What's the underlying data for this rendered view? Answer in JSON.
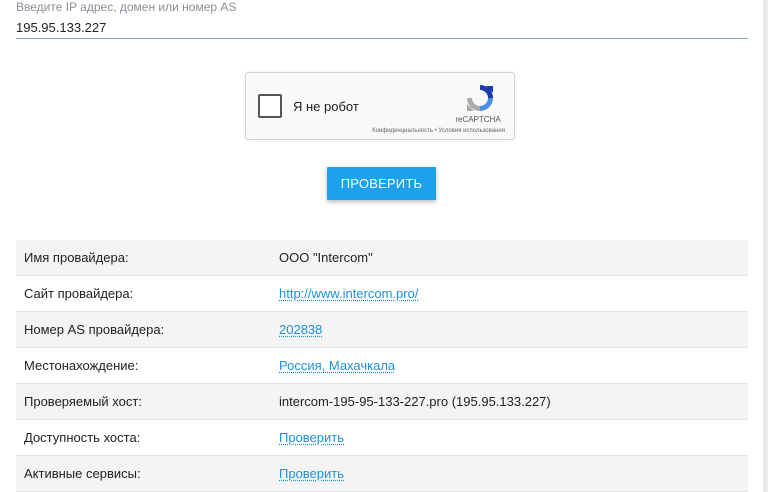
{
  "search": {
    "label": "Введите IP адрес, домен или номер AS",
    "value": "195.95.133.227"
  },
  "captcha": {
    "checkbox_label": "Я не робот",
    "brand": "reCAPTCHA",
    "links": "Конфиденциальность • Условия использования",
    "logo_icon": "recaptcha-logo-icon"
  },
  "check_button": {
    "label": "ПРОВЕРИТЬ",
    "color": "#1ea1ec"
  },
  "info": {
    "rows": [
      {
        "key": "Имя провайдера:",
        "value": "ООО \"Intercom\""
      },
      {
        "key": "Сайт провайдера:",
        "value": "http://www.intercom.pro/"
      },
      {
        "key": "Номер AS провайдера:",
        "value": "202838"
      },
      {
        "key": "Местонахождение:",
        "value": "Россия, Махачкала"
      },
      {
        "key": "Проверяемый хост:",
        "value": "intercom-195-95-133-227.pro (195.95.133.227)"
      },
      {
        "key": "Доступность хоста:",
        "value": "Проверить"
      },
      {
        "key": "Активные сервисы:",
        "value": "Проверить"
      }
    ]
  },
  "colors": {
    "link": "#1e90d8",
    "row_alt": "#f4f4f4"
  }
}
